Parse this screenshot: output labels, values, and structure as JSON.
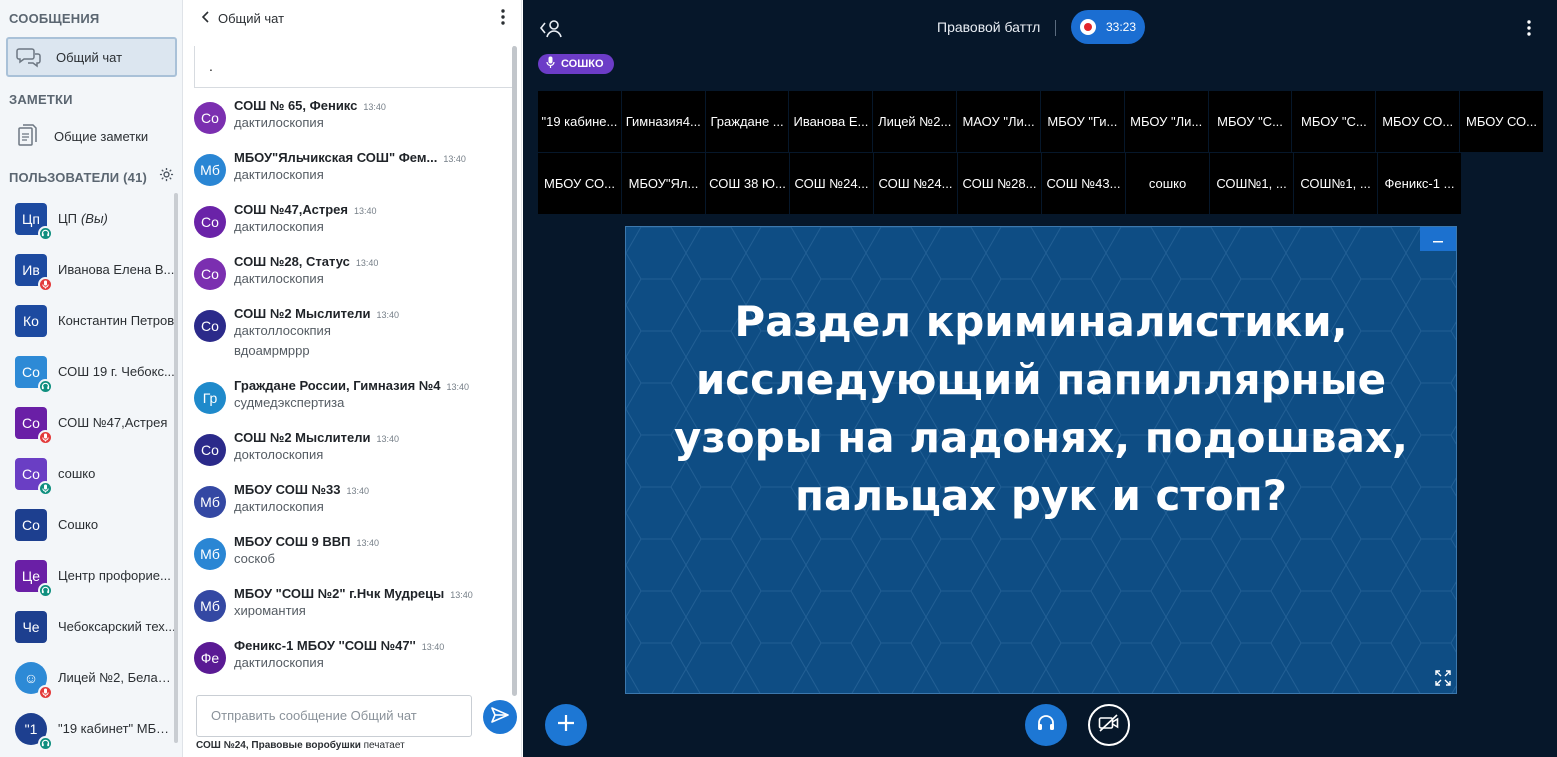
{
  "left_panel": {
    "messages_title": "СООБЩЕНИЯ",
    "public_chat_label": "Общий чат",
    "notes_title": "ЗАМЕТКИ",
    "shared_notes_label": "Общие заметки",
    "users_title": "ПОЛЬЗОВАТЕЛИ (41)",
    "users": [
      {
        "initials": "Цп",
        "name": "ЦП",
        "you": "(Вы)",
        "color": "#1d4aa0",
        "badge": "headset",
        "shape": "square"
      },
      {
        "initials": "Ив",
        "name": "Иванова Елена В...",
        "color": "#1d4aa0",
        "badge": "mic-off",
        "shape": "square"
      },
      {
        "initials": "Ко",
        "name": "Константин Петров",
        "color": "#1d4aa0",
        "badge": "",
        "shape": "square"
      },
      {
        "initials": "Со",
        "name": "СОШ 19 г. Чебокс...",
        "color": "#2d8ad6",
        "badge": "headset",
        "shape": "square"
      },
      {
        "initials": "Со",
        "name": "СОШ №47,Астрея",
        "color": "#6a1fa6",
        "badge": "mic-off",
        "shape": "square"
      },
      {
        "initials": "Со",
        "name": "сошко",
        "color": "#6a3ec4",
        "badge": "mic-on",
        "shape": "square"
      },
      {
        "initials": "Со",
        "name": "Сошко",
        "color": "#1d3f8f",
        "badge": "",
        "shape": "square"
      },
      {
        "initials": "Це",
        "name": "Центр профорие...",
        "color": "#6a1fa6",
        "badge": "headset",
        "shape": "square"
      },
      {
        "initials": "Че",
        "name": "Чебоксарский тех...",
        "color": "#1d3f8f",
        "badge": "",
        "shape": "square"
      },
      {
        "initials": "☺",
        "name": "Лицей №2, Белая ...",
        "color": "#2d8ad6",
        "badge": "mic-off",
        "shape": "round"
      },
      {
        "initials": "\"1",
        "name": "\"19 кабинет\" МБО...",
        "color": "#1d3f8f",
        "badge": "headset",
        "shape": "round"
      }
    ]
  },
  "chat": {
    "title": "Общий чат",
    "welcome_text": ".",
    "messages": [
      {
        "initials": "Со",
        "color": "#7b2fb0",
        "author": "СОШ № 65, Феникс",
        "time": "13:40",
        "lines": [
          "дактилоскопия"
        ]
      },
      {
        "initials": "Мб",
        "color": "#2a86d4",
        "author": "МБОУ\"Яльчикская СОШ\" Фем...",
        "time": "13:40",
        "lines": [
          "дактилоскопия"
        ]
      },
      {
        "initials": "Со",
        "color": "#6a23a8",
        "author": "СОШ №47,Астрея",
        "time": "13:40",
        "lines": [
          "дактилоскопия"
        ]
      },
      {
        "initials": "Со",
        "color": "#7b2fb0",
        "author": "СОШ №28, Статус",
        "time": "13:40",
        "lines": [
          "дактилоскопия"
        ]
      },
      {
        "initials": "Со",
        "color": "#2b2a8a",
        "author": "СОШ №2 Мыслители",
        "time": "13:40",
        "lines": [
          "дактоллосокпия",
          "вдоамрмррр"
        ]
      },
      {
        "initials": "Гр",
        "color": "#1f8acb",
        "author": "Граждане России, Гимназия №4",
        "time": "13:40",
        "lines": [
          "судмедэкспертиза"
        ]
      },
      {
        "initials": "Со",
        "color": "#2b2a8a",
        "author": "СОШ №2 Мыслители",
        "time": "13:40",
        "lines": [
          "доктолоскопия"
        ]
      },
      {
        "initials": "Мб",
        "color": "#3448a3",
        "author": "МБОУ СОШ №33",
        "time": "13:40",
        "lines": [
          "дактилоскопия"
        ]
      },
      {
        "initials": "Мб",
        "color": "#2a86d4",
        "author": "МБОУ СОШ 9 ВВП",
        "time": "13:40",
        "lines": [
          "соскоб"
        ]
      },
      {
        "initials": "Мб",
        "color": "#3448a3",
        "author": "МБОУ \"СОШ №2\" г.Нчк Мудрецы",
        "time": "13:40",
        "lines": [
          "хиромантия"
        ]
      },
      {
        "initials": "Фе",
        "color": "#5a1a94",
        "author": "Феникс-1 МБОУ ''СОШ №47''",
        "time": "13:40",
        "lines": [
          "дактилоскопия"
        ]
      }
    ],
    "input_placeholder": "Отправить сообщение Общий чат",
    "typing_name": "СОШ №24, Правовые воробушки",
    "typing_suffix": " печатает"
  },
  "main": {
    "room_title": "Правовой баттл",
    "recording_time": "33:23",
    "talking_user": "СОШКО",
    "tiles_row1": [
      "\"19 кабине...",
      "Гимназия4...",
      "Граждане ...",
      "Иванова Е...",
      "Лицей №2...",
      "МАОУ \"Ли...",
      "МБОУ \"Ги...",
      "МБОУ \"Ли...",
      "МБОУ \"С...",
      "МБОУ \"С...",
      "МБОУ СО...",
      "МБОУ СО..."
    ],
    "tiles_row2": [
      "МБОУ СО...",
      "МБОУ\"Ял...",
      "СОШ 38 Ю...",
      "СОШ №24...",
      "СОШ №24...",
      "СОШ №28...",
      "СОШ №43...",
      "сошко",
      "СОШ№1, ...",
      "СОШ№1, ...",
      "Феникс-1 ..."
    ],
    "slide_text_lines": [
      "Раздел криминалистики,",
      "исследующий папиллярные",
      "узоры на ладонях, подошвах,",
      "пальцах рук и стоп?"
    ],
    "slide_color": "#0e4d84",
    "accent_color": "#1d77d4"
  }
}
